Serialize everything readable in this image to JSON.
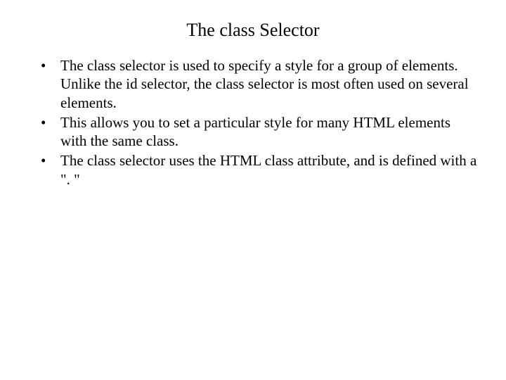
{
  "title": "The class Selector",
  "bullets": [
    "The class selector is used to specify a style for a group of elements. Unlike the id selector, the class selector is most often used on several elements.",
    "This allows you to set a particular style for many HTML elements with the same class.",
    "The class selector uses the HTML class attribute, and is defined with a \". \""
  ]
}
